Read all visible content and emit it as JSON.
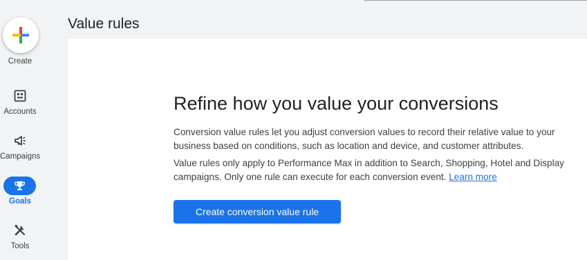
{
  "nav": {
    "create_label": "Create",
    "items": [
      {
        "label": "Accounts",
        "icon": "accounts-icon"
      },
      {
        "label": "Campaigns",
        "icon": "campaigns-icon"
      },
      {
        "label": "Goals",
        "icon": "trophy-icon",
        "active": true
      },
      {
        "label": "Tools",
        "icon": "tools-icon"
      }
    ]
  },
  "page": {
    "title": "Value rules"
  },
  "empty_state": {
    "headline": "Refine how you value your conversions",
    "paragraph1": "Conversion value rules let you adjust conversion values to record their relative value to your business based on conditions, such as location and device, and customer attributes.",
    "paragraph2_text": "Value rules only apply to Performance Max in addition to Search, Shopping, Hotel and Display campaigns. Only one rule can execute for each conversion event.",
    "learn_more": "Learn more",
    "cta_label": "Create conversion value rule"
  },
  "colors": {
    "accent": "#1a73e8",
    "rail_bg": "#f1f3f4",
    "card_bg": "#ffffff"
  }
}
